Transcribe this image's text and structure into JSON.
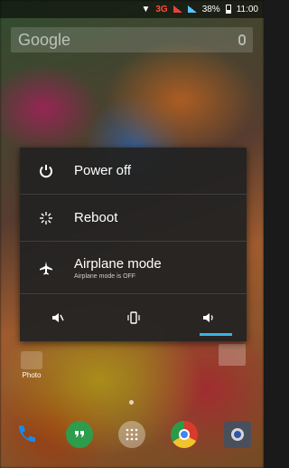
{
  "status_bar": {
    "network": "3G",
    "battery_percent": "38%",
    "time": "11:00"
  },
  "search": {
    "placeholder": "Google"
  },
  "power_menu": {
    "items": [
      {
        "label": "Power off",
        "icon": "power-icon"
      },
      {
        "label": "Reboot",
        "icon": "reboot-icon"
      },
      {
        "label": "Airplane mode",
        "sublabel": "Airplane mode is OFF",
        "icon": "airplane-icon"
      }
    ],
    "sound_modes": [
      {
        "name": "silent",
        "icon": "sound-off-icon",
        "active": false
      },
      {
        "name": "vibrate",
        "icon": "vibrate-icon",
        "active": false
      },
      {
        "name": "sound-on",
        "icon": "sound-on-icon",
        "active": true
      }
    ],
    "accent_color": "#35b6e6"
  },
  "home": {
    "folder_label": "Photo",
    "dock_apps": [
      "phone-icon",
      "hangouts-icon",
      "app-drawer-icon",
      "chrome-icon",
      "camera-icon"
    ]
  }
}
